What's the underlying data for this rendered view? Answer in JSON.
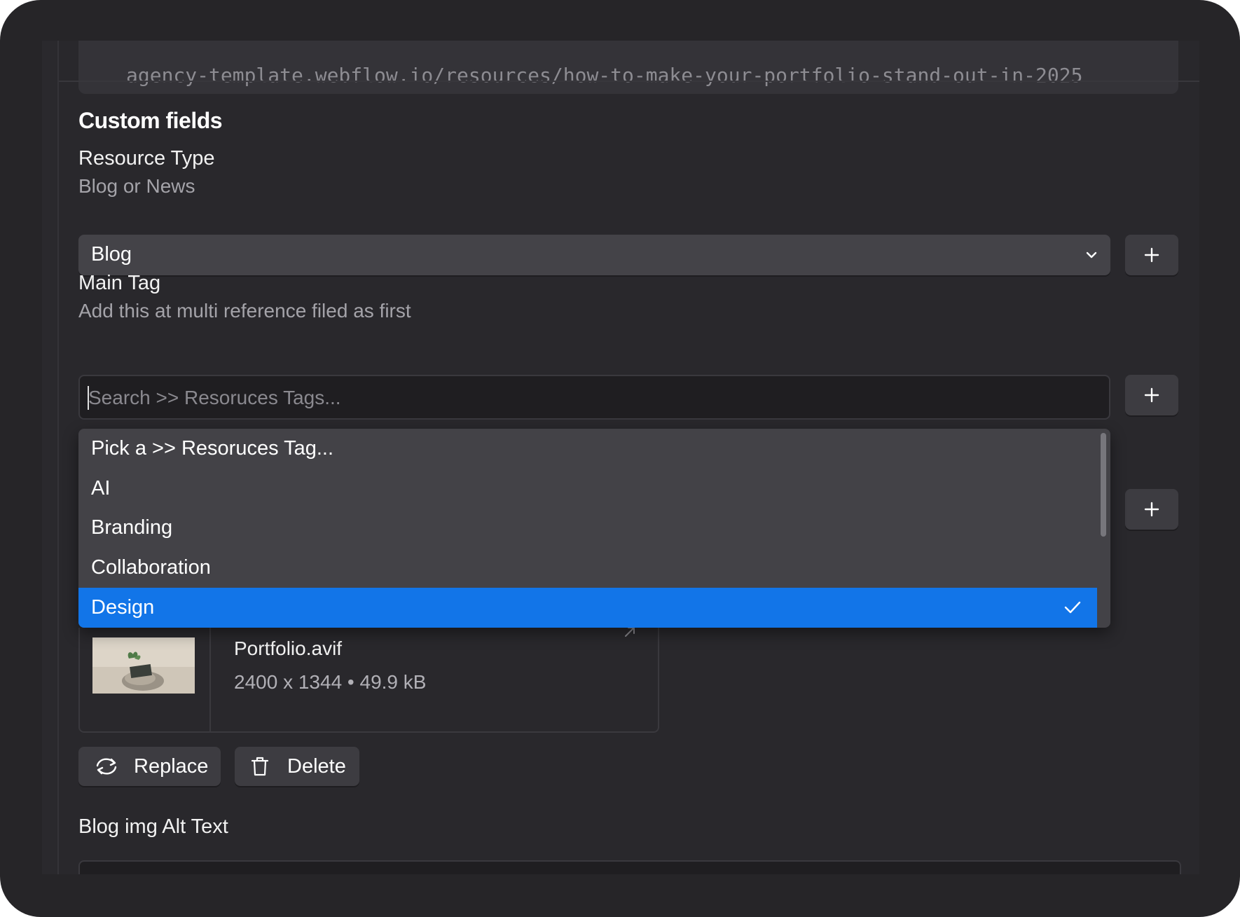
{
  "top_field": {
    "value": "agency-template.webflow.io/resources/how-to-make-your-portfolio-stand-out-in-2025"
  },
  "section": {
    "title": "Custom fields"
  },
  "resource_type": {
    "label": "Resource Type",
    "help": "Blog or News",
    "selected": "Blog"
  },
  "main_tag": {
    "label": "Main Tag",
    "help": "Add this at multi reference filed as first",
    "search_placeholder": "Search >> Resoruces Tags...",
    "options": [
      {
        "label": "Pick a >> Resoruces Tag..."
      },
      {
        "label": "AI"
      },
      {
        "label": "Branding"
      },
      {
        "label": "Collaboration"
      },
      {
        "label": "Design"
      }
    ],
    "selected": "Design"
  },
  "file": {
    "name": "Portfolio.avif",
    "meta": "2400 x 1344 • 49.9 kB"
  },
  "actions": {
    "replace": "Replace",
    "delete": "Delete"
  },
  "alt_text": {
    "label": "Blog img Alt Text"
  },
  "colors": {
    "background": "#262528",
    "panel": "#29282c",
    "accent": "#1275e8"
  }
}
